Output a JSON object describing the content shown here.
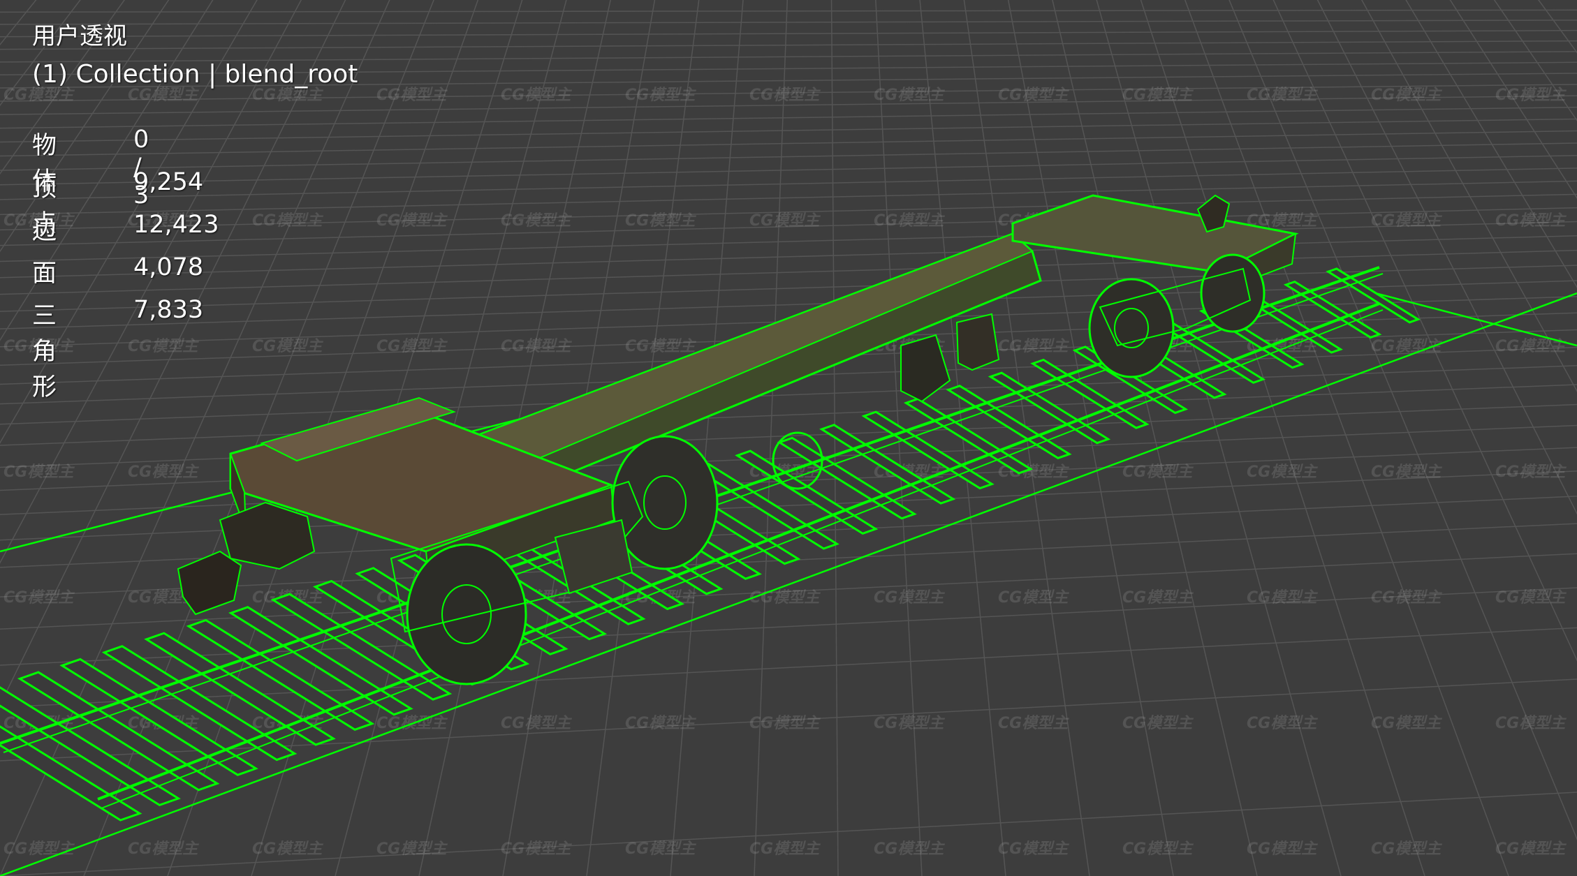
{
  "viewport": {
    "view_name": "用户透视",
    "collection_line": "(1) Collection | blend_root",
    "background_color": "#3d3d3d",
    "grid_color": "#555555",
    "wire_color": "#00ff00"
  },
  "stats": [
    {
      "label": "物体",
      "value": "0 / 3"
    },
    {
      "label": "顶点",
      "value": "9,254"
    },
    {
      "label": "边",
      "value": "12,423"
    },
    {
      "label": "面",
      "value": "4,078"
    },
    {
      "label": "三角形",
      "value": "7,833"
    }
  ],
  "watermark": {
    "text": "CG模型主"
  },
  "model": {
    "name": "railway-flat-wagon-on-track",
    "icon": "wireframe-mesh"
  }
}
